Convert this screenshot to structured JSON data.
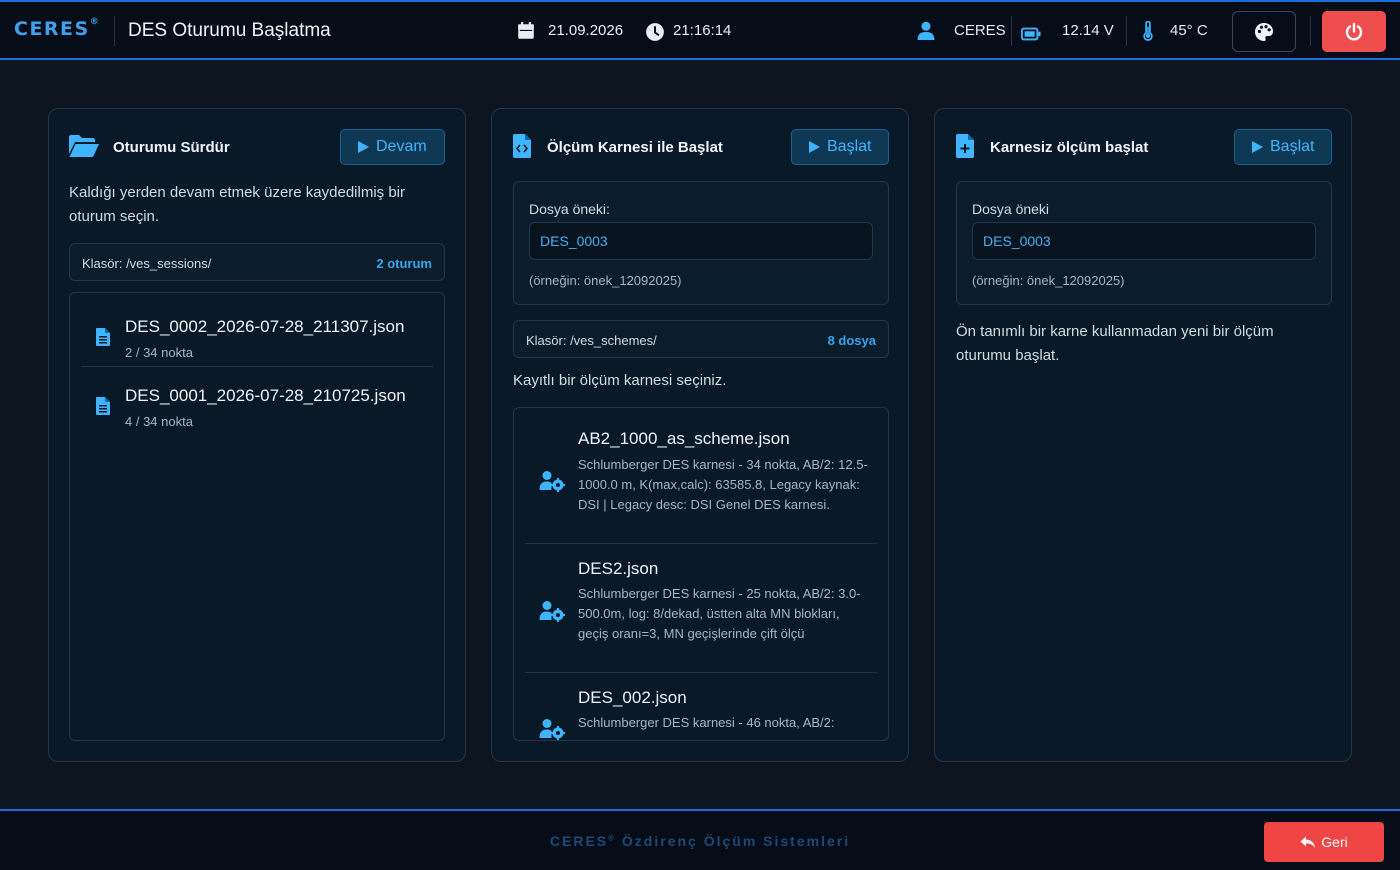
{
  "header": {
    "brand": "CERES",
    "brand_mark": "®",
    "page_title": "DES Oturumu Başlatma",
    "date": "21.09.2026",
    "time": "21:16:14",
    "user": "CERES",
    "voltage": "12.14 V",
    "temperature": "45° C",
    "icons": [
      "calendar-icon",
      "clock-icon",
      "user-icon",
      "battery-icon",
      "thermometer-icon",
      "palette-icon",
      "power-icon"
    ]
  },
  "resume_card": {
    "title": "Oturumu Sürdür",
    "button": "Devam",
    "description": "Kaldığı yerden devam etmek üzere kaydedilmiş bir oturum seçin.",
    "folder": "Klasör: /ves_sessions/",
    "count": "2 oturum",
    "sessions": [
      {
        "name": "DES_0002_2026-07-28_211307.json",
        "meta": "2 / 34 nokta"
      },
      {
        "name": "DES_0001_2026-07-28_210725.json",
        "meta": "4 / 34 nokta"
      }
    ]
  },
  "scheme_card": {
    "title": "Ölçüm Karnesi ile Başlat",
    "button": "Başlat",
    "prefix_label": "Dosya öneki:",
    "prefix_value": "DES_0003",
    "prefix_hint": "(örneğin: önek_12092025)",
    "folder": "Klasör: /ves_schemes/",
    "count": "8 dosya",
    "instruction": "Kayıtlı bir ölçüm karnesi seçiniz.",
    "schemes": [
      {
        "name": "AB2_1000_as_scheme.json",
        "desc": "Schlumberger DES karnesi - 34 nokta, AB/2: 12.5-1000.0 m, K(max,calc): 63585.8, Legacy kaynak: DSI | Legacy desc: DSI Genel DES karnesi."
      },
      {
        "name": "DES2.json",
        "desc": "Schlumberger DES karnesi - 25 nokta, AB/2: 3.0-500.0m, log: 8/dekad, üstten alta MN blokları, geçiş oranı=3, MN geçişlerinde çift ölçü"
      },
      {
        "name": "DES_002.json",
        "desc": "Schlumberger DES karnesi - 46 nokta, AB/2:"
      }
    ]
  },
  "blank_card": {
    "title": "Karnesiz ölçüm başlat",
    "button": "Başlat",
    "prefix_label": "Dosya öneki",
    "prefix_value": "DES_0003",
    "prefix_hint": "(örneğin: önek_12092025)",
    "description": "Ön tanımlı bir karne kullanmadan yeni bir ölçüm oturumu başlat."
  },
  "footer": {
    "brand": "CERES",
    "brand_mark": "®",
    "tagline": "Özdirenç Ölçüm Sistemleri",
    "back_button": "Geri"
  },
  "colors": {
    "accent": "#3fa0ef",
    "danger": "#ef4e4e",
    "background": "#0d1520",
    "card": "#0a1927"
  }
}
